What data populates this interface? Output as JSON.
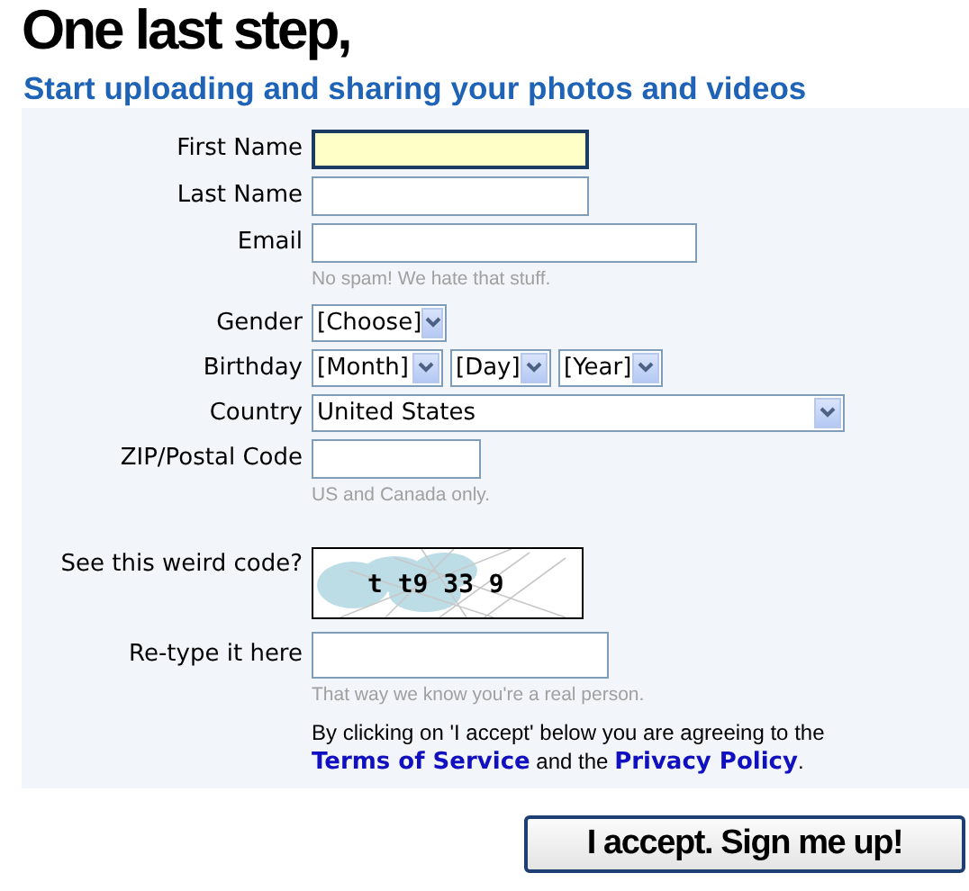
{
  "heading": "One last step,",
  "subheading": "Start uploading and sharing your photos and videos",
  "fields": [
    {
      "kind": "text",
      "label": "First Name",
      "focused": true
    },
    {
      "kind": "text",
      "label": "Last Name",
      "focused": false
    },
    {
      "kind": "email",
      "label": "Email",
      "focused": false,
      "hint": "No spam! We hate that stuff."
    },
    {
      "kind": "select",
      "label": "Gender",
      "selects": [
        "[Choose]"
      ]
    },
    {
      "kind": "select",
      "label": "Birthday",
      "selects": [
        "[Month]",
        "[Day]",
        "[Year]"
      ]
    },
    {
      "kind": "wide-select",
      "label": "Country",
      "selects": [
        "United States"
      ]
    },
    {
      "kind": "postal",
      "label": "ZIP/Postal Code",
      "focused": false,
      "hint": "US and Canada only."
    },
    {
      "kind": "captcha",
      "label": "See this weird code?",
      "code": "t t9 33 9"
    },
    {
      "kind": "answer",
      "label": "Re-type it here",
      "focused": false,
      "hint": "That way we know you're a real person."
    }
  ],
  "agreement": {
    "before": "By clicking on 'I accept' below you are agreeing to the",
    "link_1": "Terms of Service",
    "middle": "and the",
    "link_2": "Privacy Policy",
    "after": "."
  },
  "submit_button": "I accept. Sign me up!"
}
